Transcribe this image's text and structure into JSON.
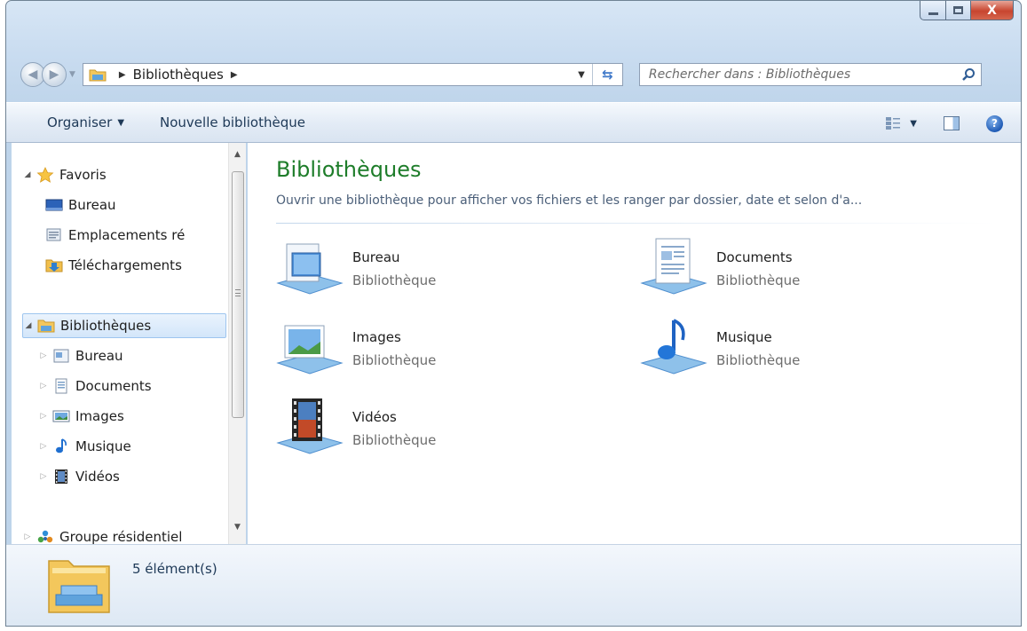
{
  "window": {
    "controls": {
      "minimize": "minimize-icon",
      "maximize": "maximize-icon",
      "close_label": "X"
    }
  },
  "address_bar": {
    "path": [
      "Bibliothèques"
    ],
    "search_placeholder": "Rechercher dans : Bibliothèques"
  },
  "toolbar": {
    "organize_label": "Organiser",
    "new_library_label": "Nouvelle bibliothèque"
  },
  "nav_pane": {
    "favorites": {
      "label": "Favoris",
      "items": [
        "Bureau",
        "Emplacements ré",
        "Téléchargements"
      ]
    },
    "libraries": {
      "label": "Bibliothèques",
      "items": [
        "Bureau",
        "Documents",
        "Images",
        "Musique",
        "Vidéos"
      ]
    },
    "homegroup": {
      "label": "Groupe résidentiel"
    }
  },
  "main": {
    "title": "Bibliothèques",
    "description": "Ouvrir une bibliothèque pour afficher vos fichiers et les ranger par dossier, date et selon d'a...",
    "libraries": [
      {
        "name": "Bureau",
        "type": "Bibliothèque",
        "icon": "desktop-library-icon"
      },
      {
        "name": "Documents",
        "type": "Bibliothèque",
        "icon": "documents-library-icon"
      },
      {
        "name": "Images",
        "type": "Bibliothèque",
        "icon": "pictures-library-icon"
      },
      {
        "name": "Musique",
        "type": "Bibliothèque",
        "icon": "music-library-icon"
      },
      {
        "name": "Vidéos",
        "type": "Bibliothèque",
        "icon": "videos-library-icon"
      }
    ]
  },
  "details": {
    "count_text": "5 élément(s)"
  },
  "colors": {
    "title_green": "#1e7d2a",
    "selection_blue": "#d3e6fa",
    "close_red": "#c8452f"
  }
}
